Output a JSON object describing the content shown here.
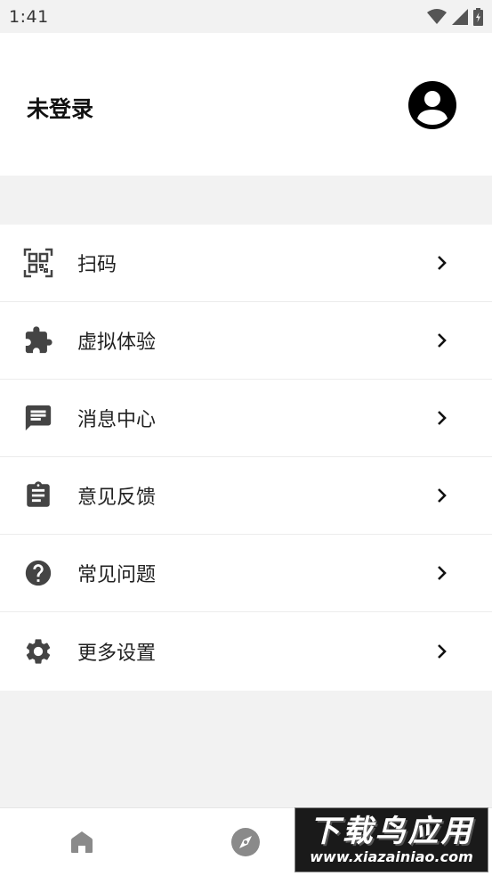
{
  "status_bar": {
    "time": "1:41"
  },
  "profile": {
    "name": "未登录"
  },
  "menu": {
    "items": [
      {
        "label": "扫码",
        "icon": "qr-scan-icon"
      },
      {
        "label": "虚拟体验",
        "icon": "puzzle-icon"
      },
      {
        "label": "消息中心",
        "icon": "message-icon"
      },
      {
        "label": "意见反馈",
        "icon": "clipboard-icon"
      },
      {
        "label": "常见问题",
        "icon": "help-icon"
      },
      {
        "label": "更多设置",
        "icon": "gear-icon"
      }
    ]
  },
  "bottom_nav": {
    "items": [
      "home-icon",
      "compass-icon"
    ]
  },
  "watermark": {
    "title": "下载鸟应用",
    "url": "www.xiazainiao.com"
  },
  "colors": {
    "icon": "#444444",
    "background": "#f2f2f2",
    "surface": "#ffffff"
  }
}
